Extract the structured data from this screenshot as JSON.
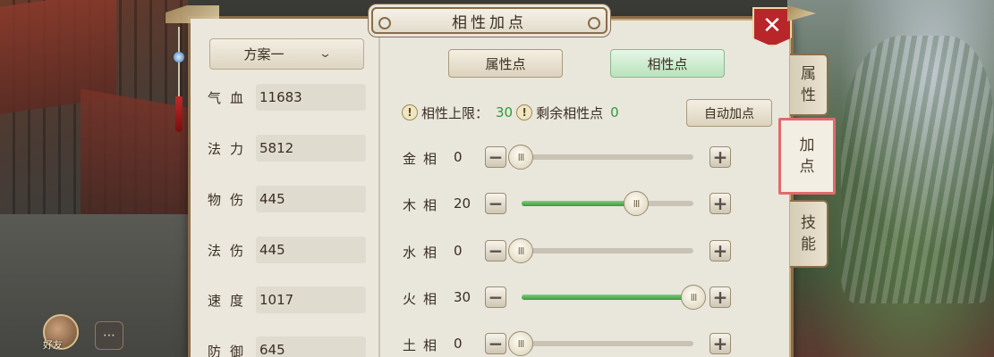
{
  "window": {
    "title": "相性加点"
  },
  "scheme": {
    "selected": "方案一"
  },
  "stats": [
    {
      "label": "气血",
      "value": "11683"
    },
    {
      "label": "法力",
      "value": "5812"
    },
    {
      "label": "物伤",
      "value": "445"
    },
    {
      "label": "法伤",
      "value": "445"
    },
    {
      "label": "速度",
      "value": "1017"
    },
    {
      "label": "防御",
      "value": "645"
    }
  ],
  "tabs": {
    "attr_points": "属性点",
    "affinity_points": "相性点"
  },
  "info": {
    "cap_label": "相性上限：",
    "cap_value": "30",
    "remaining_label": "剩余相性点",
    "remaining_value": "0",
    "warn_glyph": "!"
  },
  "auto_button": "自动加点",
  "affinities": [
    {
      "label": "金相",
      "value": "0",
      "level": 0
    },
    {
      "label": "木相",
      "value": "20",
      "level": 20
    },
    {
      "label": "水相",
      "value": "0",
      "level": 0
    },
    {
      "label": "火相",
      "value": "30",
      "level": 30
    },
    {
      "label": "土相",
      "value": "0",
      "level": 0
    }
  ],
  "affinity_max": 30,
  "side_tabs": [
    {
      "line1": "属",
      "line2": "性"
    },
    {
      "line1": "加",
      "line2": "点"
    },
    {
      "line1": "技",
      "line2": "能"
    }
  ],
  "friend": {
    "label": "好友"
  },
  "icons": {
    "close": "close-icon",
    "minus": "minus-icon",
    "plus": "plus-icon",
    "dropdown": "chevron-down-icon",
    "warning": "warning-icon",
    "chat": "chat-icon"
  },
  "colors": {
    "accent_green": "#2f9a3a",
    "close_red": "#b8262a",
    "active_tab_border": "#e06b6b"
  }
}
